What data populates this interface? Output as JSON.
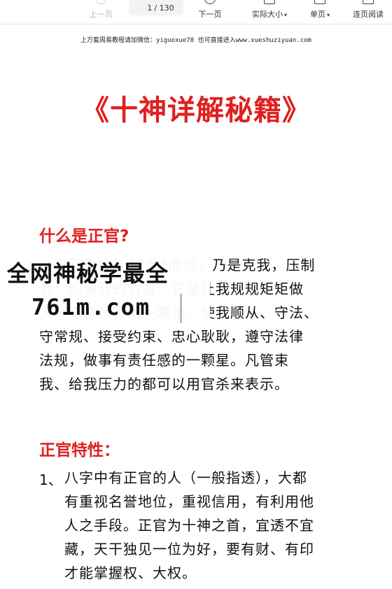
{
  "toolbar": {
    "prev_label": "上一页",
    "page_current": "1",
    "page_total": "/ 130",
    "next_label": "下一页",
    "actual_size_label": "实际大小",
    "single_page_label": "单页",
    "continuous_label": "连页阅读"
  },
  "notice": "上万套周易教程请加微信：yiguoxue78  也可直接进入www.xueshuziyuan.com",
  "document": {
    "title": "《十神详解秘籍》",
    "section1": {
      "heading": "什么是正官?",
      "lines": [
        "正官对日主\"我\"而言，乃是克我，压制",
        "我、约束我的力量，它是让我规规矩矩做",
        "人、谨言慎行的一颗星，使我顺从、守法、",
        "守常规、接受约束、忠心耿耿，遵守法律",
        "法规，做事有责任感的一颗星。凡管束",
        "我、给我压力的都可以用官杀来表示。"
      ]
    },
    "section2": {
      "heading": "正官特性：",
      "item_number": "1、",
      "item_lines": [
        "八字中有正官的人（一般指透），大都",
        "有重视名誉地位，重视信用，有利用他",
        "人之手段。正官为十神之首，宜透不宜",
        "藏，天干独见一位为好，要有财、有印",
        "才能掌握权、大权。"
      ]
    }
  },
  "watermark": {
    "line1": "全网神秘学最全",
    "line2": "761m.com"
  }
}
